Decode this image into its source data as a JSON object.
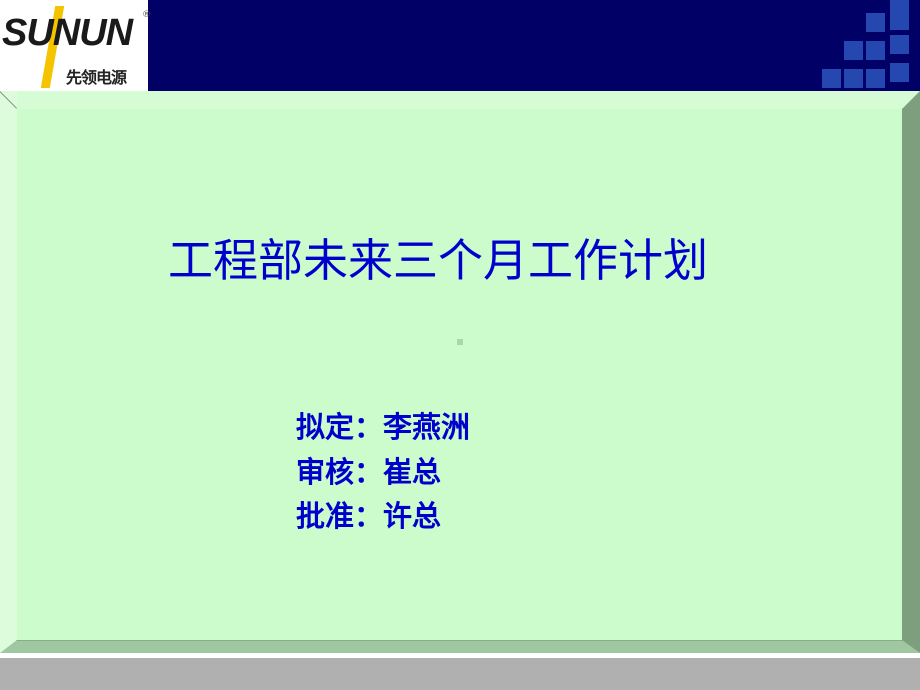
{
  "header": {
    "logo": {
      "brand": "SUNUN",
      "registered_mark": "®",
      "subtitle": "先领电源"
    },
    "colors": {
      "background": "#000066",
      "squares": "#2448b0",
      "logo_accent": "#f5c400"
    }
  },
  "slide": {
    "title": "工程部未来三个月工作计划",
    "signatures": [
      {
        "label": "拟定：",
        "value": "李燕洲"
      },
      {
        "label": "审核：",
        "value": "崔总"
      },
      {
        "label": "批准：",
        "value": "许总"
      }
    ],
    "colors": {
      "text": "#0000cc",
      "panel": "#ccfccc"
    }
  }
}
